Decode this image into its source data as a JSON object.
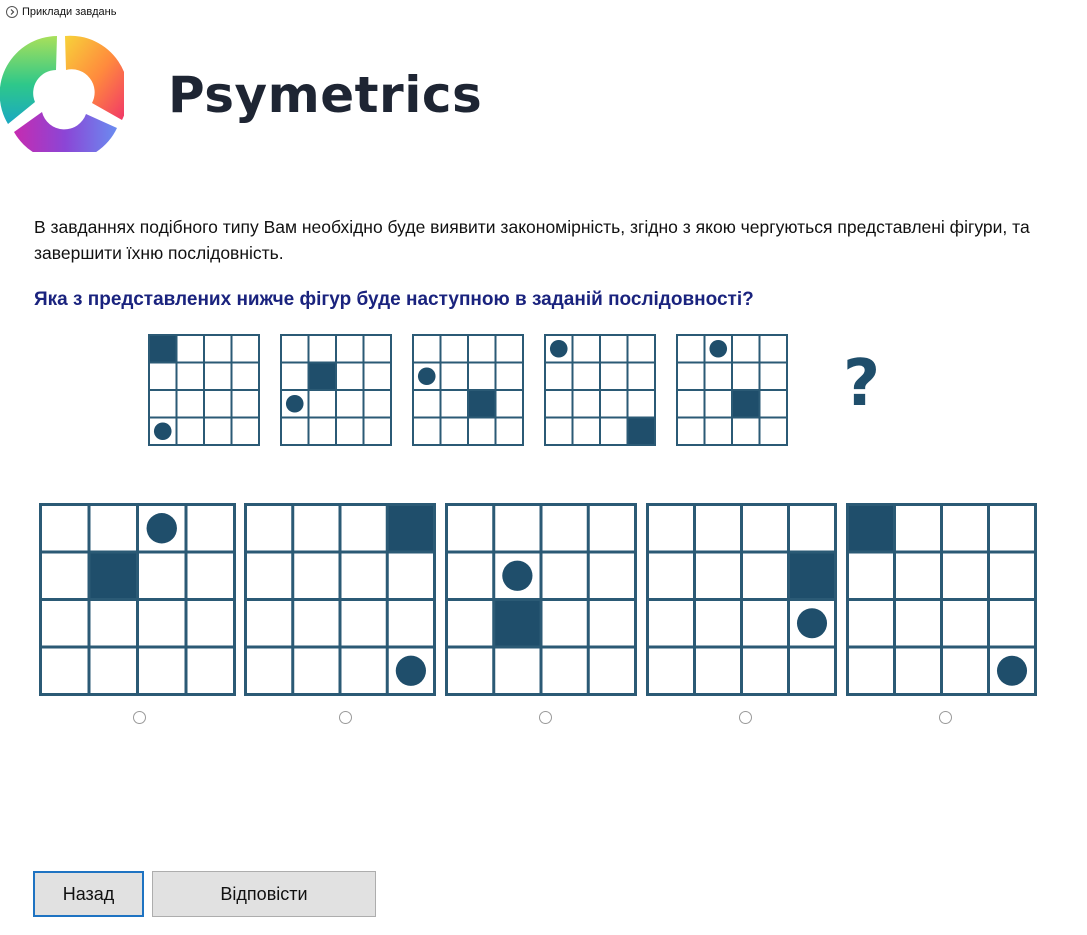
{
  "header": {
    "back_link_label": "Приклади завдань",
    "brand_name": "Psymetrics"
  },
  "task": {
    "instruction": "В завданнях подібного типу Вам необхідно буде виявити закономірність, згідно з якою чергуються представлені фігури, та завершити їхню послідовність.",
    "question": "Яка з представлених нижче фігур буде наступною в заданій послідовності?",
    "unknown_mark": "?"
  },
  "grid_size": 4,
  "sequence": [
    {
      "square": [
        0,
        0
      ],
      "circle": [
        3,
        0
      ]
    },
    {
      "square": [
        1,
        1
      ],
      "circle": [
        2,
        0
      ]
    },
    {
      "square": [
        2,
        2
      ],
      "circle": [
        1,
        0
      ]
    },
    {
      "square": [
        3,
        3
      ],
      "circle": [
        0,
        0
      ]
    },
    {
      "square": [
        2,
        2
      ],
      "circle": [
        0,
        1
      ]
    }
  ],
  "options": [
    {
      "square": [
        1,
        1
      ],
      "circle": [
        0,
        2
      ]
    },
    {
      "square": [
        0,
        3
      ],
      "circle": [
        3,
        3
      ]
    },
    {
      "square": [
        2,
        1
      ],
      "circle": [
        1,
        1
      ]
    },
    {
      "square": [
        1,
        3
      ],
      "circle": [
        2,
        3
      ]
    },
    {
      "square": [
        0,
        0
      ],
      "circle": [
        3,
        3
      ]
    }
  ],
  "buttons": {
    "back_label": "Назад",
    "answer_label": "Відповісти"
  },
  "colors": {
    "cell_fill": "#1f4e6b",
    "grid_line": "#2b5a75",
    "question_text": "#1a237e"
  }
}
